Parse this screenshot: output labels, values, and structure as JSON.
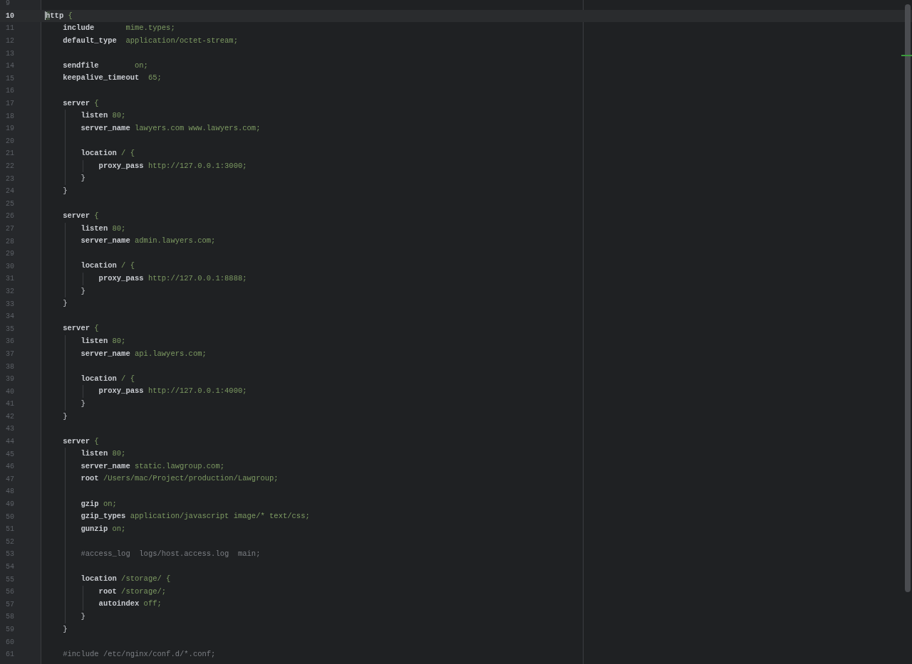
{
  "editor": {
    "lines": [
      {
        "number": "9",
        "current": false
      },
      {
        "number": "10",
        "current": true,
        "tokens": [
          {
            "kind": "directive",
            "text": "http"
          },
          {
            "kind": "value",
            "text": " {"
          }
        ],
        "children": [
          {
            "number": "11",
            "current": false,
            "tokens": [
              {
                "kind": "directive",
                "text": "include"
              },
              {
                "kind": "value",
                "text": "       mime.types;"
              }
            ]
          },
          {
            "number": "12",
            "current": false,
            "tokens": [
              {
                "kind": "directive",
                "text": "default_type"
              },
              {
                "kind": "value",
                "text": "  application/octet-stream;"
              }
            ]
          },
          {
            "number": "13",
            "current": false
          },
          {
            "number": "14",
            "current": false,
            "tokens": [
              {
                "kind": "directive",
                "text": "sendfile"
              },
              {
                "kind": "value",
                "text": "        on;"
              }
            ]
          },
          {
            "number": "15",
            "current": false,
            "tokens": [
              {
                "kind": "directive",
                "text": "keepalive_timeout"
              },
              {
                "kind": "value",
                "text": "  65;"
              }
            ]
          },
          {
            "number": "16",
            "current": false
          },
          {
            "number": "17",
            "current": false,
            "tokens": [
              {
                "kind": "directive",
                "text": "server"
              },
              {
                "kind": "value",
                "text": " {"
              }
            ],
            "children": [
              {
                "number": "18",
                "current": false,
                "tokens": [
                  {
                    "kind": "directive",
                    "text": "listen"
                  },
                  {
                    "kind": "value",
                    "text": " 80;"
                  }
                ]
              },
              {
                "number": "19",
                "current": false,
                "tokens": [
                  {
                    "kind": "directive",
                    "text": "server_name"
                  },
                  {
                    "kind": "value",
                    "text": " lawyers.com www.lawyers.com;"
                  }
                ]
              },
              {
                "number": "20",
                "current": false
              },
              {
                "number": "21",
                "current": false,
                "tokens": [
                  {
                    "kind": "directive",
                    "text": "location"
                  },
                  {
                    "kind": "value",
                    "text": " / {"
                  }
                ],
                "children": [
                  {
                    "number": "22",
                    "current": false,
                    "tokens": [
                      {
                        "kind": "directive",
                        "text": "proxy_pass"
                      },
                      {
                        "kind": "value",
                        "text": " http://127.0.0.1:3000;"
                      }
                    ]
                  }
                ]
              },
              {
                "number": "23",
                "current": false,
                "tokens": [
                  {
                    "kind": "brace",
                    "text": "}"
                  }
                ]
              }
            ]
          },
          {
            "number": "24",
            "current": false,
            "tokens": [
              {
                "kind": "brace",
                "text": "}"
              }
            ]
          },
          {
            "number": "25",
            "current": false
          },
          {
            "number": "26",
            "current": false,
            "tokens": [
              {
                "kind": "directive",
                "text": "server"
              },
              {
                "kind": "value",
                "text": " {"
              }
            ],
            "children": [
              {
                "number": "27",
                "current": false,
                "tokens": [
                  {
                    "kind": "directive",
                    "text": "listen"
                  },
                  {
                    "kind": "value",
                    "text": " 80;"
                  }
                ]
              },
              {
                "number": "28",
                "current": false,
                "tokens": [
                  {
                    "kind": "directive",
                    "text": "server_name"
                  },
                  {
                    "kind": "value",
                    "text": " admin.lawyers.com;"
                  }
                ]
              },
              {
                "number": "29",
                "current": false
              },
              {
                "number": "30",
                "current": false,
                "tokens": [
                  {
                    "kind": "directive",
                    "text": "location"
                  },
                  {
                    "kind": "value",
                    "text": " / {"
                  }
                ],
                "children": [
                  {
                    "number": "31",
                    "current": false,
                    "tokens": [
                      {
                        "kind": "directive",
                        "text": "proxy_pass"
                      },
                      {
                        "kind": "value",
                        "text": " http://127.0.0.1:8888;"
                      }
                    ]
                  }
                ]
              },
              {
                "number": "32",
                "current": false,
                "tokens": [
                  {
                    "kind": "brace",
                    "text": "}"
                  }
                ]
              }
            ]
          },
          {
            "number": "33",
            "current": false,
            "tokens": [
              {
                "kind": "brace",
                "text": "}"
              }
            ]
          },
          {
            "number": "34",
            "current": false
          },
          {
            "number": "35",
            "current": false,
            "tokens": [
              {
                "kind": "directive",
                "text": "server"
              },
              {
                "kind": "value",
                "text": " {"
              }
            ],
            "children": [
              {
                "number": "36",
                "current": false,
                "tokens": [
                  {
                    "kind": "directive",
                    "text": "listen"
                  },
                  {
                    "kind": "value",
                    "text": " 80;"
                  }
                ]
              },
              {
                "number": "37",
                "current": false,
                "tokens": [
                  {
                    "kind": "directive",
                    "text": "server_name"
                  },
                  {
                    "kind": "value",
                    "text": " api.lawyers.com;"
                  }
                ]
              },
              {
                "number": "38",
                "current": false
              },
              {
                "number": "39",
                "current": false,
                "tokens": [
                  {
                    "kind": "directive",
                    "text": "location"
                  },
                  {
                    "kind": "value",
                    "text": " / {"
                  }
                ],
                "children": [
                  {
                    "number": "40",
                    "current": false,
                    "tokens": [
                      {
                        "kind": "directive",
                        "text": "proxy_pass"
                      },
                      {
                        "kind": "value",
                        "text": " http://127.0.0.1:4000;"
                      }
                    ]
                  }
                ]
              },
              {
                "number": "41",
                "current": false,
                "tokens": [
                  {
                    "kind": "brace",
                    "text": "}"
                  }
                ]
              }
            ]
          },
          {
            "number": "42",
            "current": false,
            "tokens": [
              {
                "kind": "brace",
                "text": "}"
              }
            ]
          },
          {
            "number": "43",
            "current": false
          },
          {
            "number": "44",
            "current": false,
            "tokens": [
              {
                "kind": "directive",
                "text": "server"
              },
              {
                "kind": "value",
                "text": " {"
              }
            ],
            "children": [
              {
                "number": "45",
                "current": false,
                "tokens": [
                  {
                    "kind": "directive",
                    "text": "listen"
                  },
                  {
                    "kind": "value",
                    "text": " 80;"
                  }
                ]
              },
              {
                "number": "46",
                "current": false,
                "tokens": [
                  {
                    "kind": "directive",
                    "text": "server_name"
                  },
                  {
                    "kind": "value",
                    "text": " static.lawgroup.com;"
                  }
                ]
              },
              {
                "number": "47",
                "current": false,
                "tokens": [
                  {
                    "kind": "directive",
                    "text": "root"
                  },
                  {
                    "kind": "value",
                    "text": " /Users/mac/Project/production/Lawgroup;"
                  }
                ]
              },
              {
                "number": "48",
                "current": false
              },
              {
                "number": "49",
                "current": false,
                "tokens": [
                  {
                    "kind": "directive",
                    "text": "gzip"
                  },
                  {
                    "kind": "value",
                    "text": " on;"
                  }
                ]
              },
              {
                "number": "50",
                "current": false,
                "tokens": [
                  {
                    "kind": "directive",
                    "text": "gzip_types"
                  },
                  {
                    "kind": "value",
                    "text": " application/javascript image/* text/css;"
                  }
                ]
              },
              {
                "number": "51",
                "current": false,
                "tokens": [
                  {
                    "kind": "directive",
                    "text": "gunzip"
                  },
                  {
                    "kind": "value",
                    "text": " on;"
                  }
                ]
              },
              {
                "number": "52",
                "current": false
              },
              {
                "number": "53",
                "current": false,
                "tokens": [
                  {
                    "kind": "comment",
                    "text": "#access_log  logs/host.access.log  main;"
                  }
                ]
              },
              {
                "number": "54",
                "current": false
              },
              {
                "number": "55",
                "current": false,
                "tokens": [
                  {
                    "kind": "directive",
                    "text": "location"
                  },
                  {
                    "kind": "value",
                    "text": " /storage/ {"
                  }
                ],
                "children": [
                  {
                    "number": "56",
                    "current": false,
                    "tokens": [
                      {
                        "kind": "directive",
                        "text": "root"
                      },
                      {
                        "kind": "value",
                        "text": " /storage/;"
                      }
                    ]
                  },
                  {
                    "number": "57",
                    "current": false,
                    "tokens": [
                      {
                        "kind": "directive",
                        "text": "autoindex"
                      },
                      {
                        "kind": "value",
                        "text": " off;"
                      }
                    ]
                  }
                ]
              },
              {
                "number": "58",
                "current": false,
                "tokens": [
                  {
                    "kind": "brace",
                    "text": "}"
                  }
                ]
              }
            ]
          },
          {
            "number": "59",
            "current": false,
            "tokens": [
              {
                "kind": "brace",
                "text": "}"
              }
            ]
          },
          {
            "number": "60",
            "current": false
          },
          {
            "number": "61",
            "current": false,
            "tokens": [
              {
                "kind": "comment",
                "text": "#include /etc/nginx/conf.d/*.conf;"
              }
            ]
          }
        ]
      }
    ]
  }
}
